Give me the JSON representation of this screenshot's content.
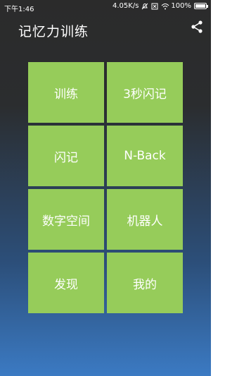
{
  "status_bar": {
    "time": "下午1:46",
    "network_speed": "4.05K/s",
    "icons": [
      "alarm-icon",
      "sim-icon",
      "wifi-icon",
      "battery-icon"
    ],
    "battery_percent": "100%",
    "battery_level": 1.0
  },
  "header": {
    "title": "记忆力训练",
    "share_icon": "share-icon"
  },
  "menu": {
    "tiles": [
      {
        "label": "训练"
      },
      {
        "label": "3秒闪记"
      },
      {
        "label": "闪记"
      },
      {
        "label": "N-Back"
      },
      {
        "label": "数字空间"
      },
      {
        "label": "机器人"
      },
      {
        "label": "发现"
      },
      {
        "label": "我的"
      }
    ]
  },
  "colors": {
    "tile": "#96cc5a",
    "background_top": "#2b2b2b",
    "background_bottom": "#3b7ac3",
    "text": "#ffffff"
  }
}
